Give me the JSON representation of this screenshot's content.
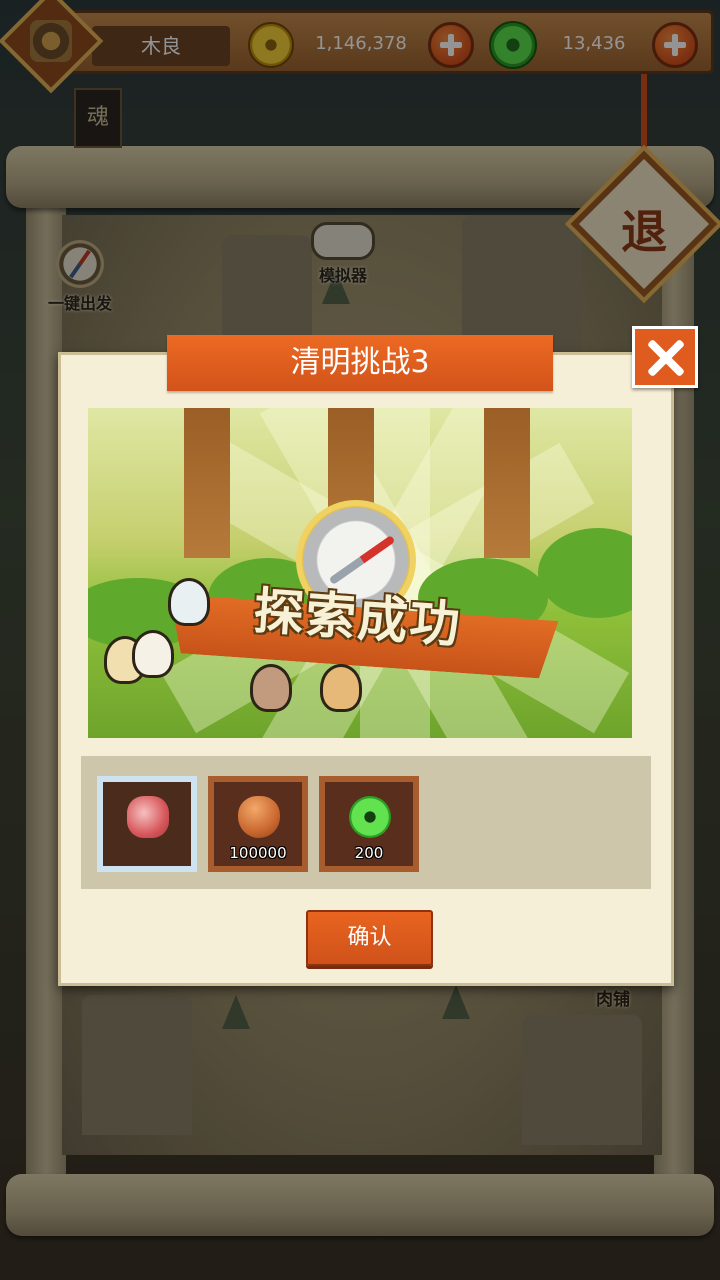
{
  "player": {
    "name": "木良"
  },
  "currency": {
    "gold": "1,146,378",
    "jade": "13,436",
    "gold_icon": "gold-coin-icon",
    "jade_icon": "jade-disc-icon"
  },
  "top_right": {
    "exit_label": "退"
  },
  "side_tags": {
    "soul": "魂"
  },
  "map": {
    "dispatch_label": "一键出发",
    "emulator_label": "模拟器",
    "shop_label": "肉铺"
  },
  "dialog": {
    "title": "清明挑战3",
    "banner_text": "探索成功",
    "confirm_label": "确认",
    "rewards": [
      {
        "name": "meat",
        "icon": "meat-icon",
        "quantity": ""
      },
      {
        "name": "gold-bag",
        "icon": "gold-bag-icon",
        "quantity": "100000"
      },
      {
        "name": "jade",
        "icon": "jade-icon",
        "quantity": "200"
      }
    ]
  },
  "colors": {
    "accent_orange": "#e05b1e",
    "parchment": "#f6efd7",
    "wood_frame": "#9b6331"
  }
}
